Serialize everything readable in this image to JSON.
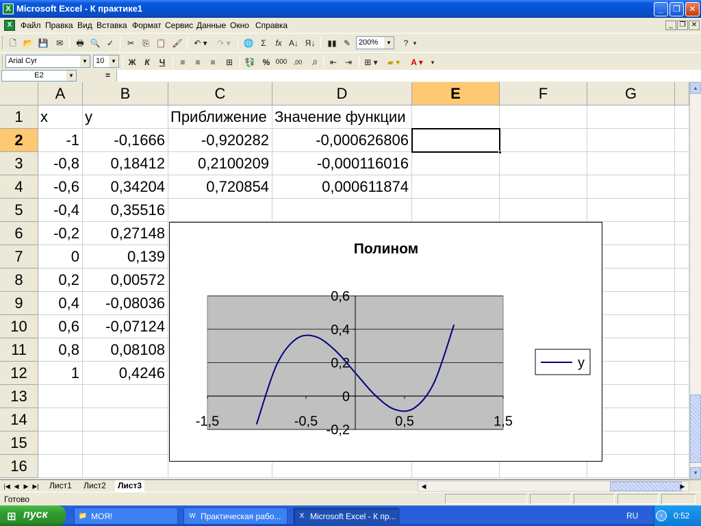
{
  "window": {
    "title": "Microsoft Excel - К практике1",
    "app_icon": "X",
    "buttons": [
      "_",
      "❐",
      "✕"
    ]
  },
  "menu": {
    "items": [
      "Файл",
      "Правка",
      "Вид",
      "Вставка",
      "Формат",
      "Сервис",
      "Данные",
      "Окно",
      "Справка"
    ],
    "mdi_buttons": [
      "_",
      "❐",
      "✕"
    ]
  },
  "toolbar": {
    "zoom": "200%",
    "font_name": "Arial Cyr",
    "font_size": "10",
    "bold": "Ж",
    "italic": "К",
    "underline": "Ч",
    "sigma": "Σ",
    "fx": "fx",
    "percent": "%",
    "thousands": "000",
    "dec_inc": ",00",
    "dec_dec": ",0",
    "help": "?"
  },
  "formula_bar": {
    "name_box": "E2",
    "equals": "=",
    "content": ""
  },
  "grid": {
    "columns": [
      "A",
      "B",
      "C",
      "D",
      "E",
      "F",
      "G"
    ],
    "active_column": "E",
    "rows": [
      "1",
      "2",
      "3",
      "4",
      "5",
      "6",
      "7",
      "8",
      "9",
      "10",
      "11",
      "12",
      "13",
      "14",
      "15",
      "16"
    ],
    "active_row": "2",
    "headers": {
      "A1": "x",
      "B1": "y",
      "C1": "Приближение",
      "D1": "Значение функции"
    },
    "values_A": [
      "-1",
      "-0,8",
      "-0,6",
      "-0,4",
      "-0,2",
      "0",
      "0,2",
      "0,4",
      "0,6",
      "0,8",
      "1"
    ],
    "values_B": [
      "-0,1666",
      "0,18412",
      "0,34204",
      "0,35516",
      "0,27148",
      "0,139",
      "0,00572",
      "-0,08036",
      "-0,07124",
      "0,08108",
      "0,4246"
    ],
    "values_C": [
      "-0,920282",
      "0,2100209",
      "0,720854"
    ],
    "values_D": [
      "-0,000626806",
      "-0,000116016",
      "0,000611874"
    ],
    "selected_cell": "E2"
  },
  "chart_data": {
    "type": "line",
    "title": "Полином",
    "legend": "right",
    "series": [
      {
        "name": "y",
        "color": "#000080",
        "x": [
          -1,
          -0.8,
          -0.6,
          -0.4,
          -0.2,
          0,
          0.2,
          0.4,
          0.6,
          0.8,
          1
        ],
        "values": [
          -0.1666,
          0.18412,
          0.34204,
          0.35516,
          0.27148,
          0.139,
          0.00572,
          -0.08036,
          -0.07124,
          0.08108,
          0.4246
        ]
      }
    ],
    "xlim": [
      -1.5,
      1.5
    ],
    "ylim": [
      -0.2,
      0.6
    ],
    "x_ticks": [
      "-1,5",
      "-0,5",
      "0,5",
      "1,5"
    ],
    "y_ticks": [
      "-0,2",
      "0",
      "0,2",
      "0,4",
      "0,6"
    ],
    "plot_bg": "#c0c0c0",
    "grid": true
  },
  "sheets": {
    "tabs": [
      "Лист1",
      "Лист2",
      "Лист3"
    ],
    "active": "Лист3"
  },
  "status": {
    "text": "Готово"
  },
  "taskbar": {
    "start_label": "пуск",
    "tasks": [
      "МОЯ!",
      "Практическая рабо...",
      "Microsoft Excel - К пр..."
    ],
    "active_task": 2,
    "lang": "RU",
    "clock": "0:52"
  },
  "colors": {
    "titlebar": "#0552d6",
    "active_header": "#ffc873",
    "series_line": "#000080",
    "plot_area": "#c0c0c0"
  }
}
